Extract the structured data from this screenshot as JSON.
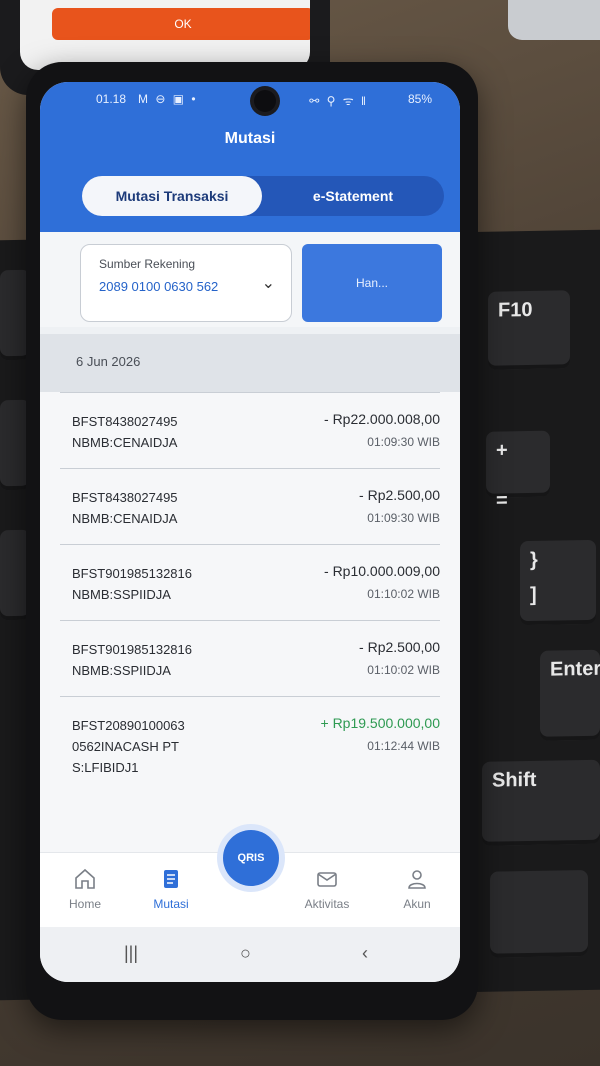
{
  "background": {
    "top_phone_button": "OK",
    "keyboard_keys": [
      "F10",
      "+",
      "=",
      "}",
      "]",
      "Enter",
      "Shift"
    ]
  },
  "status_bar": {
    "time": "01.18",
    "left_icons": "M ⊖ ▣ •",
    "right_icons": "⚯ ⚲ ᯤ ‖",
    "battery": "85%"
  },
  "header": {
    "title": "Mutasi",
    "tabs": [
      {
        "label": "Mutasi Transaksi",
        "active": true
      },
      {
        "label": "e-Statement",
        "active": false
      }
    ]
  },
  "account": {
    "label": "Sumber Rekening",
    "number": "2089 0100 0630 562",
    "action_label": "Han..."
  },
  "date_header": "6 Jun 2026",
  "transactions": [
    {
      "desc": "BFST8438027495\nNBMB:CENAIDJA",
      "amount": "- Rp22.000.008,00",
      "time": "01:09:30 WIB",
      "type": "debit"
    },
    {
      "desc": "BFST8438027495\nNBMB:CENAIDJA",
      "amount": "- Rp2.500,00",
      "time": "01:09:30 WIB",
      "type": "debit"
    },
    {
      "desc": "BFST901985132816\nNBMB:SSPIIDJA",
      "amount": "- Rp10.000.009,00",
      "time": "01:10:02 WIB",
      "type": "debit"
    },
    {
      "desc": "BFST901985132816\nNBMB:SSPIIDJA",
      "amount": "- Rp2.500,00",
      "time": "01:10:02 WIB",
      "type": "debit"
    },
    {
      "desc": "BFST20890100063\n0562INACASH PT\nS:LFIBIDJ1",
      "amount": "+ Rp19.500.000,00",
      "time": "01:12:44 WIB",
      "type": "credit"
    }
  ],
  "bottom_nav": {
    "items": [
      {
        "label": "Home",
        "icon": "home-icon",
        "active": false
      },
      {
        "label": "Mutasi",
        "icon": "document-icon",
        "active": true
      },
      {
        "label": "Aktivitas",
        "icon": "mail-icon",
        "active": false
      },
      {
        "label": "Akun",
        "icon": "user-icon",
        "active": false
      }
    ],
    "qris_label": "QRIS"
  },
  "android_nav": {
    "recent": "|||",
    "home": "○",
    "back": "‹"
  },
  "colors": {
    "brand_blue": "#2f6fd8",
    "credit_green": "#2e9a52",
    "accent_orange": "#e8541c"
  }
}
